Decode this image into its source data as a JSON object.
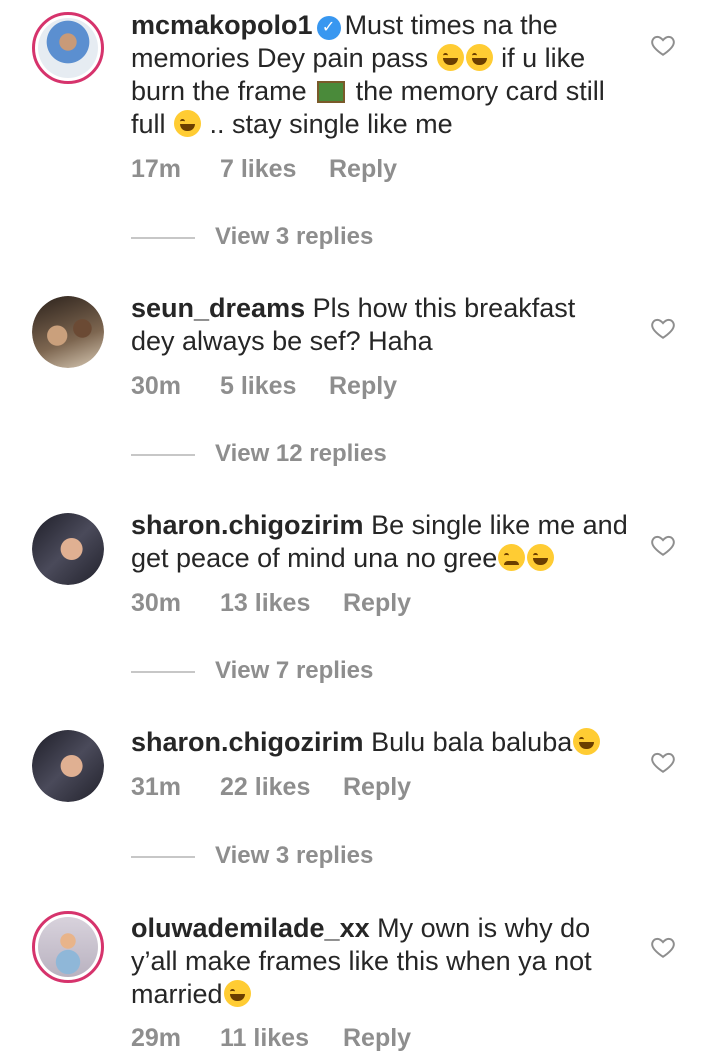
{
  "comments": [
    {
      "username": "mcmakopolo1",
      "verified": true,
      "avatar_colors": [
        "#6fa0d8",
        "#e0e6ee"
      ],
      "line1": "Must times na the",
      "line2": "memories Dey pain pass",
      "line2b": "if u like",
      "line3a": "burn the frame",
      "line3b": "the memory card still",
      "line4a": "full",
      "line4b": ".. stay single like me",
      "time": "17m",
      "likes": "7 likes",
      "reply": "Reply",
      "view_replies": "View 3 replies"
    },
    {
      "username": "seun_dreams",
      "avatar_colors": [
        "#3a2b22",
        "#9a7a5c"
      ],
      "line1": "Pls how this breakfast",
      "line2": "dey always be sef? Haha",
      "time": "30m",
      "likes": "5 likes",
      "reply": "Reply",
      "view_replies": "View 12 replies"
    },
    {
      "username": "sharon.chigozirim",
      "avatar_colors": [
        "#2a2a35",
        "#d8a58a"
      ],
      "line1": "Be single like me and",
      "line2": "get peace of mind una no gree",
      "time": "30m",
      "likes": "13 likes",
      "reply": "Reply",
      "view_replies": "View 7 replies"
    },
    {
      "username": "sharon.chigozirim",
      "avatar_colors": [
        "#2a2a35",
        "#d8a58a"
      ],
      "line1": "Bulu bala baluba",
      "time": "31m",
      "likes": "22 likes",
      "reply": "Reply",
      "view_replies": "View 3 replies"
    },
    {
      "username": "oluwademilade_xx",
      "avatar_colors": [
        "#c9c3cf",
        "#e8b48a"
      ],
      "line1": "My own is why do",
      "line2": "y’all make frames like this when ya not",
      "line3": "married",
      "time": "29m",
      "likes": "11 likes",
      "reply": "Reply"
    }
  ],
  "colors": {
    "secondary_text": "#8e8e8e",
    "verified": "#3897f0",
    "story_ring": "#d6336c"
  }
}
